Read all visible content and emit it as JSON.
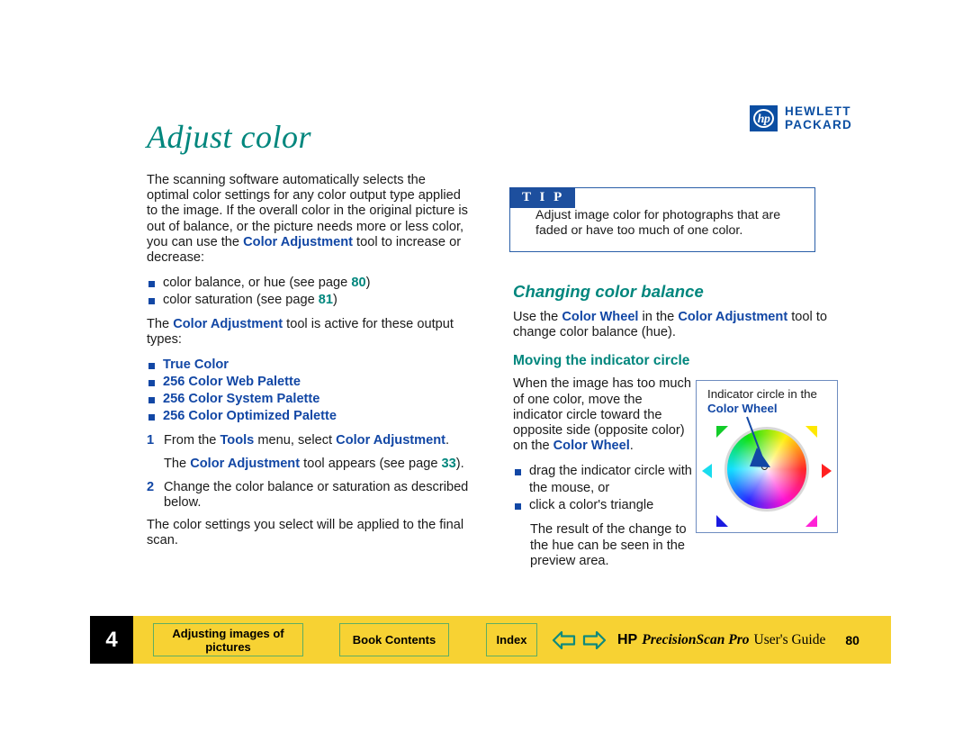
{
  "logo": {
    "mark_text": "hp",
    "line1": "HEWLETT",
    "line2": "PACKARD",
    "color": "#0b4ea2"
  },
  "title": "Adjust color",
  "colors": {
    "heading_teal": "#00867d",
    "link_blue": "#1247a5",
    "tip_blue": "#1d4f9e",
    "footer_yellow": "#f7d233",
    "footer_button_border": "#5fae62"
  },
  "left_column": {
    "intro": {
      "part1": "The scanning software automatically selects the optimal color settings for any color output type applied to the image. If the overall color in the original picture is out of balance, or the picture needs more or less color, you can use the ",
      "link1": "Color Adjustment",
      "part2": " tool to increase or decrease:"
    },
    "capability_bullets": [
      {
        "text_before": "color balance, or hue (see page ",
        "page_ref": "80",
        "text_after": ")"
      },
      {
        "text_before": "color saturation (see page ",
        "page_ref": "81",
        "text_after": ")"
      }
    ],
    "active_types_intro": {
      "part1": "The ",
      "link1": "Color Adjustment",
      "part2": " tool is active for these output types:"
    },
    "output_types": [
      "True Color",
      "256 Color Web Palette",
      "256 Color System Palette",
      "256 Color Optimized Palette"
    ],
    "steps": [
      {
        "number": "1",
        "part1": "From the ",
        "link1": "Tools",
        "part2": " menu, select ",
        "link2": "Color Adjustment",
        "part3": "."
      },
      {
        "number": "2",
        "part1": "Change the color balance or saturation as described below.",
        "link1": "",
        "part2": "",
        "link2": "",
        "part3": ""
      }
    ],
    "substep": {
      "part1": "The ",
      "link1": "Color Adjustment",
      "part2": " tool appears (see page ",
      "page_ref": "33",
      "part3": ")."
    },
    "closing": "The color settings you select will be applied to the final scan."
  },
  "tip": {
    "badge": "T I P",
    "text": "Adjust image color for photographs that are faded or have too much of one color."
  },
  "right_column": {
    "section_heading": "Changing color balance",
    "section_intro": {
      "part1": "Use the ",
      "link1": "Color Wheel",
      "part2": " in the ",
      "link2": "Color Adjustment",
      "part3": " tool to change color balance (hue)."
    },
    "sub_heading": "Moving the indicator circle",
    "instruction": {
      "part1": "When the image has too much of one color, move the indicator circle toward the opposite side (opposite color) on the ",
      "link1": "Color Wheel",
      "part2": "."
    },
    "action_bullets": [
      "drag the indicator circle with the mouse, or",
      "click a color's triangle"
    ],
    "result_text": "The result of the change to the hue can be seen in the preview area."
  },
  "figure": {
    "caption": {
      "part1": "Indicator circle in the ",
      "link1": "Color Wheel"
    },
    "wheel_colors": {
      "right": "#ff2020",
      "upper_right": "#ffe800",
      "upper_left": "#12cc29",
      "left": "#19dcee",
      "lower_left": "#1a1ae0",
      "lower_right": "#ff22d6"
    }
  },
  "footer": {
    "chapter": "4",
    "section_button": "Adjusting images of pictures",
    "contents_button": "Book Contents",
    "index_button": "Index",
    "brand_hp": "HP",
    "brand_product": "PrecisionScan Pro",
    "brand_guide": "User's Guide",
    "page_number": "80"
  }
}
